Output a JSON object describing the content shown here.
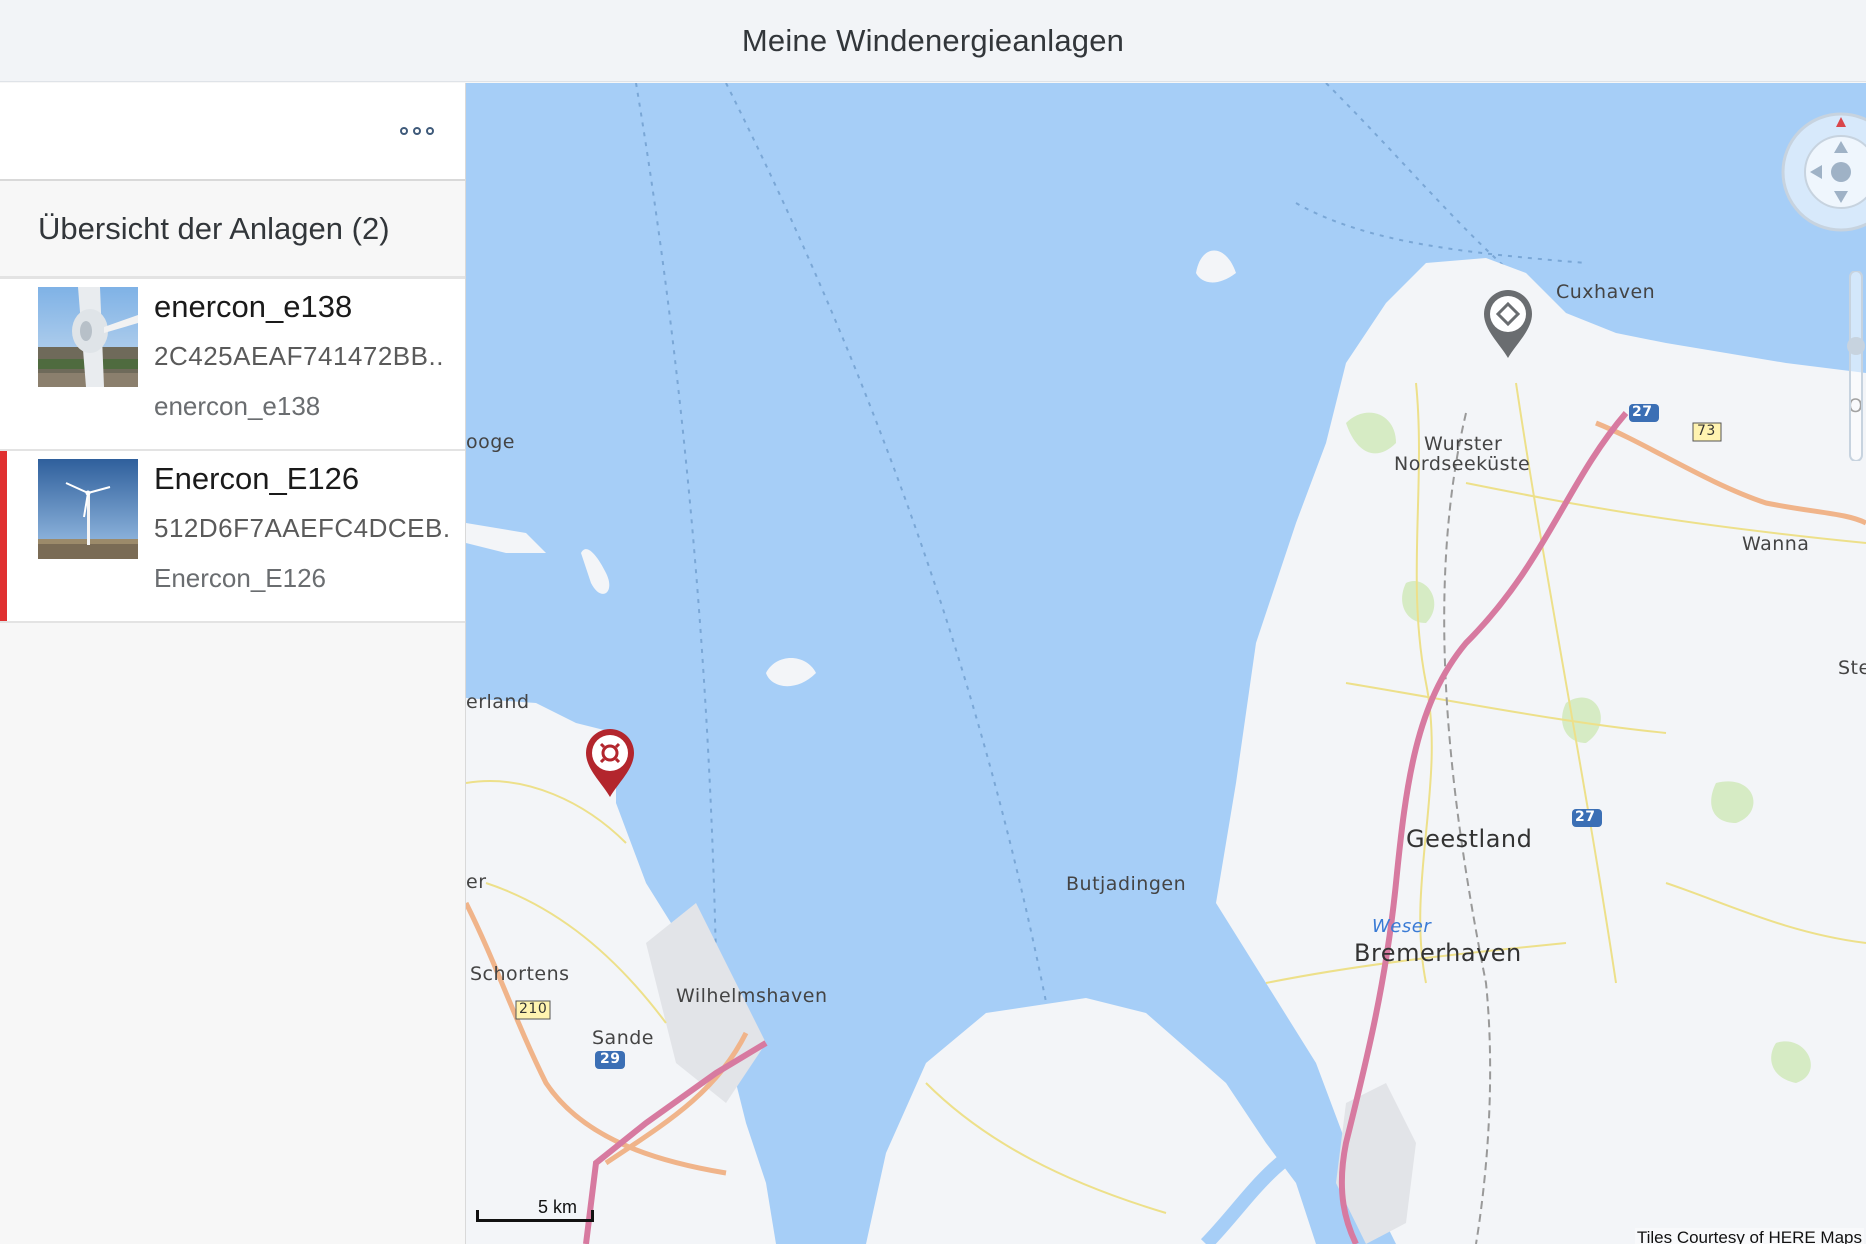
{
  "header": {
    "title": "Meine Windenergieanlagen"
  },
  "sidebar": {
    "overflow_icon": "overflow-dots-icon",
    "list_title": "Übersicht der Anlagen (2)",
    "items": [
      {
        "title": "enercon_e138",
        "id": "2C425AEAF741472BB..",
        "subtitle": "enercon_e138",
        "selected": false
      },
      {
        "title": "Enercon_E126",
        "id": "512D6F7AAEFC4DCEB.",
        "subtitle": "Enercon_E126",
        "selected": true
      }
    ]
  },
  "map": {
    "labels": {
      "cuxhaven": "Cuxhaven",
      "wurster_1": "Wurster",
      "wurster_2": "Nordseeküste",
      "wanna": "Wanna",
      "geestland": "Geestland",
      "butjadingen": "Butjadingen",
      "weser": "Weser",
      "bremerhaven": "Bremerhaven",
      "schortens": "Schortens",
      "wilhelmshaven": "Wilhelmshaven",
      "sande": "Sande",
      "erland": "erland",
      "oge": "ooge",
      "er": "er",
      "o_right": "O",
      "st_right": "Ste"
    },
    "road_shields": [
      "27",
      "73",
      "27",
      "210",
      "29"
    ],
    "scale_label": "5 km",
    "attribution": "Tiles Courtesy of HERE Maps",
    "colors": {
      "water": "#a6cef7",
      "land": "#f3f5f8",
      "motorway": "#d77aa0",
      "pin_selected": "#b3262d",
      "pin_default": "#6a6d70",
      "selection_bar": "#e03030"
    }
  }
}
